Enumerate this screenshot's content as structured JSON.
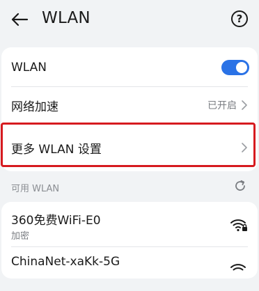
{
  "header": {
    "title": "WLAN",
    "help_glyph": "?"
  },
  "settings": {
    "wlan_label": "WLAN",
    "wlan_enabled": true,
    "accel_label": "网络加速",
    "accel_value": "已开启",
    "more_label": "更多 WLAN 设置"
  },
  "available": {
    "section_label": "可用 WLAN",
    "networks": [
      {
        "ssid": "360免费WiFi-E0",
        "status": "加密",
        "icon": "wifi-lock-icon"
      },
      {
        "ssid": "ChinaNet-xaKk-5G",
        "status": "",
        "icon": "wifi-icon"
      }
    ]
  },
  "colors": {
    "accent": "#2a72e6",
    "highlight": "#d61a1f",
    "background": "#f1f3f5"
  }
}
